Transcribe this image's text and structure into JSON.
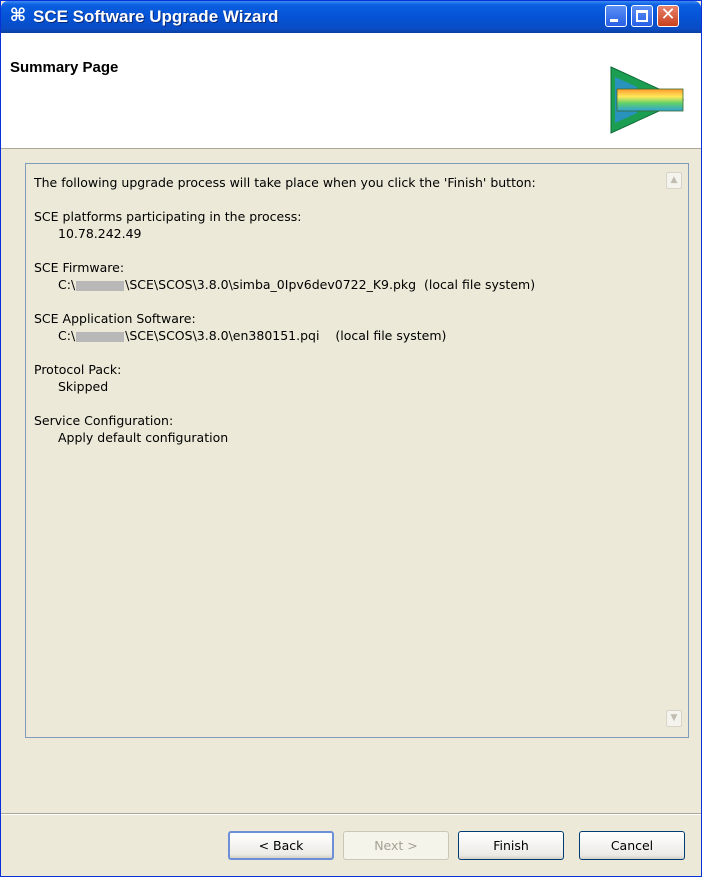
{
  "window": {
    "title": "SCE Software Upgrade Wizard",
    "controls": {
      "minimize": "minimize",
      "maximize": "maximize",
      "close": "close"
    }
  },
  "header": {
    "title": "Summary Page",
    "icon": "wizard-arrow-icon"
  },
  "summary": {
    "intro": "The following upgrade process will take place when you click the 'Finish' button:",
    "platforms_label": "SCE platforms participating in the process:",
    "platforms_value": "10.78.242.49",
    "firmware_label": "SCE Firmware:",
    "firmware_prefix": "C:\\",
    "firmware_path": "\\SCE\\SCOS\\3.8.0\\simba_0Ipv6dev0722_K9.pkg",
    "firmware_source": "(local file system)",
    "app_software_label": "SCE Application Software:",
    "app_software_prefix": "C:\\",
    "app_software_path": "\\SCE\\SCOS\\3.8.0\\en380151.pqi",
    "app_software_source": "(local file system)",
    "protocol_pack_label": "Protocol Pack:",
    "protocol_pack_value": "Skipped",
    "service_config_label": "Service Configuration:",
    "service_config_value": "Apply default configuration"
  },
  "buttons": {
    "back": "< Back",
    "next": "Next >",
    "finish": "Finish",
    "cancel": "Cancel"
  }
}
